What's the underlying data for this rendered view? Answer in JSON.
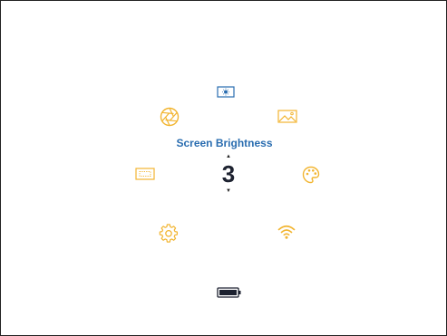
{
  "title": "Screen Brightness",
  "value": "3",
  "colors": {
    "active": "#2a6db0",
    "inactive": "#f2b531",
    "text": "#1d2230"
  },
  "menu_items": [
    {
      "icon": "brightness-icon",
      "selected": true
    },
    {
      "icon": "image-icon",
      "selected": false
    },
    {
      "icon": "palette-icon",
      "selected": false
    },
    {
      "icon": "wifi-icon",
      "selected": false
    },
    {
      "icon": "battery-icon",
      "selected": false
    },
    {
      "icon": "settings-icon",
      "selected": false
    },
    {
      "icon": "screen-frame-icon",
      "selected": false
    },
    {
      "icon": "aperture-icon",
      "selected": false
    }
  ]
}
